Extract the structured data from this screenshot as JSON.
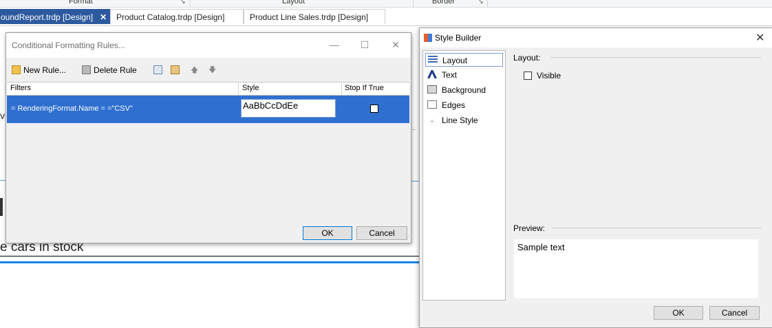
{
  "ribbon": {
    "groups": [
      "Format",
      "Layout",
      "Border"
    ],
    "launcher_glyph": "↘"
  },
  "tabs": [
    {
      "label": "oundReport.trdp [Design]",
      "active": true,
      "close": "✕"
    },
    {
      "label": "Product Catalog.trdp [Design]",
      "active": false
    },
    {
      "label": "Product Line Sales.trdp [Design]",
      "active": false
    }
  ],
  "background": {
    "caption": "e cars in stock",
    "fragment": "vi",
    "accent": "#1c84e3"
  },
  "cf_dialog": {
    "title": "Conditional Formatting Rules...",
    "minimize": "—",
    "maximize": "☐",
    "close": "✕",
    "toolbar": {
      "new_rule": "New Rule...",
      "delete_rule": "Delete Rule",
      "move_up": "🡅",
      "move_down": "🡇"
    },
    "columns": [
      "Filters",
      "Style",
      "Stop If True"
    ],
    "rows": [
      {
        "filter": "= RenderingFormat.Name = =\"CSV\"",
        "style_sample": "AaBbCcDdEe",
        "stop_if_true": false,
        "selected": true
      }
    ],
    "ok": "OK",
    "cancel": "Cancel",
    "selection_color": "#2f6fd0"
  },
  "style_builder": {
    "title": "Style Builder",
    "close": "✕",
    "categories": [
      {
        "label": "Layout",
        "icon": "layout-icon",
        "selected": true
      },
      {
        "label": "Text",
        "icon": "text-icon"
      },
      {
        "label": "Background",
        "icon": "background-icon"
      },
      {
        "label": "Edges",
        "icon": "edges-icon"
      },
      {
        "label": "Line Style",
        "icon": "line-style-icon"
      }
    ],
    "layout_header": "Layout:",
    "visible_label": "Visible",
    "visible_checked": false,
    "preview_header": "Preview:",
    "preview_text": "Sample text",
    "ok": "OK",
    "cancel": "Cancel"
  }
}
